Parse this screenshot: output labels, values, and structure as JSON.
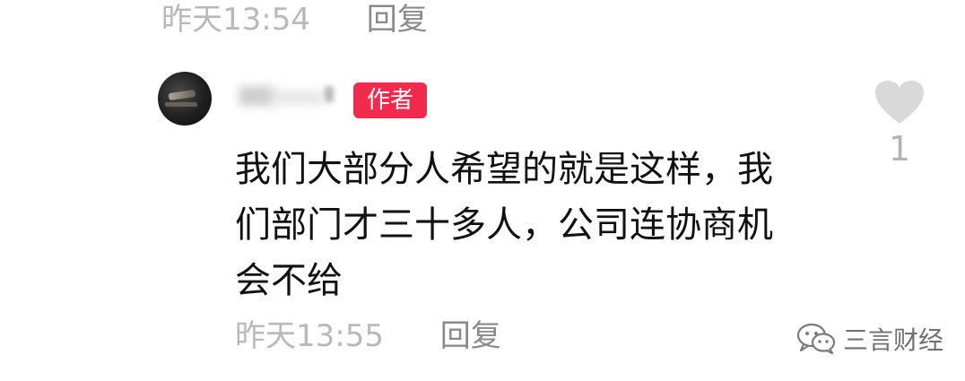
{
  "previous_comment_meta": {
    "time": "昨天13:54",
    "reply_label": "回复"
  },
  "comment": {
    "author_badge": "作者",
    "text_lines": [
      "我们大部分人希望的就是这样，我",
      "们部门才三十多人，公司连协商机",
      "会不给"
    ],
    "time": "昨天13:55",
    "reply_label": "回复",
    "like_count": "1"
  },
  "watermark": {
    "label": "三言财经",
    "icon": "wechat-icon"
  },
  "colors": {
    "badge_bg": "#f22a4d",
    "meta_text": "#b9b9b9",
    "reply_text": "#8a8a8a",
    "heart": "#d9d9d9"
  }
}
